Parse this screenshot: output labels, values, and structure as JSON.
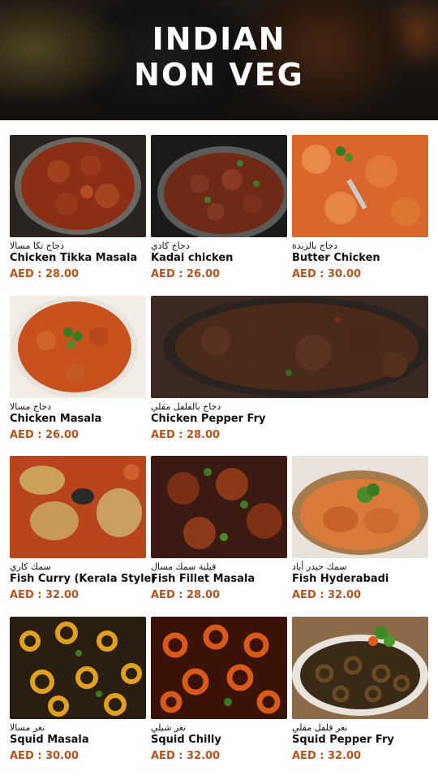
{
  "header": {
    "title_line1": "INDIAN",
    "title_line2": "NON VEG"
  },
  "colors": {
    "price": "#b4531f",
    "text": "#111111"
  },
  "items": [
    {
      "arabic": "دجاج تكا مسالا",
      "name": "Chicken Tikka Masala",
      "price": "AED : 28.00",
      "image": "chicken-tikka-masala-photo"
    },
    {
      "arabic": "دجاج كادي",
      "name": "Kadai chicken",
      "price": "AED : 26.00",
      "image": "kadai-chicken-photo"
    },
    {
      "arabic": "دجاج بالزبدة",
      "name": "Butter Chicken",
      "price": "AED : 30.00",
      "image": "butter-chicken-photo"
    },
    {
      "arabic": "دجاج مسالا",
      "name": "Chicken Masala",
      "price": "AED : 26.00",
      "image": "chicken-masala-photo"
    },
    {
      "arabic": "دجاج بالفلفل مقلي",
      "name": "Chicken Pepper Fry",
      "price": "AED : 28.00",
      "image": "chicken-pepper-fry-photo"
    },
    {
      "arabic": "سمك كاري",
      "name": "Fish Curry (Kerala Style)",
      "price": "AED : 32.00",
      "image": "fish-curry-photo"
    },
    {
      "arabic": "فيلية سمك مسال",
      "name": "Fish Fillet Masala",
      "price": "AED : 28.00",
      "image": "fish-fillet-masala-photo"
    },
    {
      "arabic": "سمك حيدر أباد",
      "name": "Fish Hyderabadi",
      "price": "AED : 32.00",
      "image": "fish-hyderabadi-photo"
    },
    {
      "arabic": "نغر مسالا",
      "name": "Squid Masala",
      "price": "AED : 30.00",
      "image": "squid-masala-photo"
    },
    {
      "arabic": "نغر شيلي",
      "name": "Squid Chilly",
      "price": "AED : 32.00",
      "image": "squid-chilly-photo"
    },
    {
      "arabic": "نغر فلفل مقلي",
      "name": "Squid Pepper Fry",
      "price": "AED : 32.00",
      "image": "squid-pepper-fry-photo"
    }
  ]
}
